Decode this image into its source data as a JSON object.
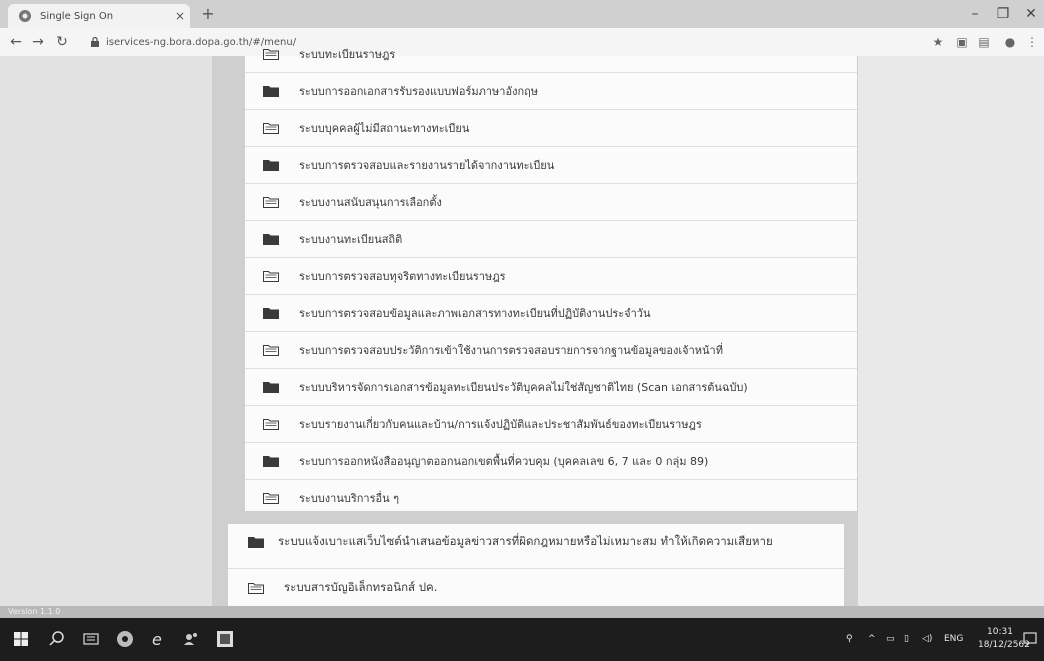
{
  "browser": {
    "tab_title": "Single Sign On",
    "tab_close": "×",
    "new_tab": "+",
    "address": "iservices-ng.bora.dopa.go.th/#/menu/",
    "win_minimize": "–",
    "win_restore": "❐",
    "win_close": "✕"
  },
  "menu": {
    "items": [
      {
        "label": "ระบบทะเบียนราษฎร"
      },
      {
        "label": "ระบบการออกเอกสารรับรองแบบฟอร์มภาษาอังกฤษ"
      },
      {
        "label": "ระบบบุคคลผู้ไม่มีสถานะทางทะเบียน"
      },
      {
        "label": "ระบบการตรวจสอบและรายงานรายได้จากงานทะเบียน"
      },
      {
        "label": "ระบบงานสนับสนุนการเลือกตั้ง"
      },
      {
        "label": "ระบบงานทะเบียนสถิติ"
      },
      {
        "label": "ระบบการตรวจสอบทุจริตทางทะเบียนราษฎร"
      },
      {
        "label": "ระบบการตรวจสอบข้อมูลและภาพเอกสารทางทะเบียนที่ปฏิบัติงานประจำวัน"
      },
      {
        "label": "ระบบการตรวจสอบประวัติการเข้าใช้งานการตรวจสอบรายการจากฐานข้อมูลของเจ้าหน้าที่"
      },
      {
        "label": "ระบบบริหารจัดการเอกสารข้อมูลทะเบียนประวัติบุคคลไม่ใช่สัญชาติไทย (Scan เอกสารต้นฉบับ)"
      },
      {
        "label": "ระบบรายงานเกี่ยวกับคนและบ้าน/การแจ้งปฏิบัติและประชาสัมพันธ์ของทะเบียนราษฎร"
      },
      {
        "label": "ระบบการออกหนังสืออนุญาตออกนอกเขตพื้นที่ควบคุม (บุคคลเลข 6, 7 และ 0 กลุ่ม 89)"
      },
      {
        "label": "ระบบงานบริการอื่น ๆ"
      }
    ]
  },
  "extra_menu": {
    "report_label": "ระบบแจ้งเบาะแสเว็บไซต์นำเสนอข้อมูลข่าวสารที่ผิดกฎหมายหรือไม่เหมาะสม ทำให้เกิดความเสียหาย",
    "ebook_label": "ระบบสารบัญอิเล็กทรอนิกส์ ปค."
  },
  "taskbar": {
    "lang": "ENG",
    "time": "10:31",
    "date": "18/12/2562"
  },
  "status": {
    "version_text": "Version 1.1.0"
  },
  "colors": {
    "accent": "#2b2b2b",
    "folder_icon": "#3a3a3a",
    "taskbar": "#1d1d1d"
  }
}
